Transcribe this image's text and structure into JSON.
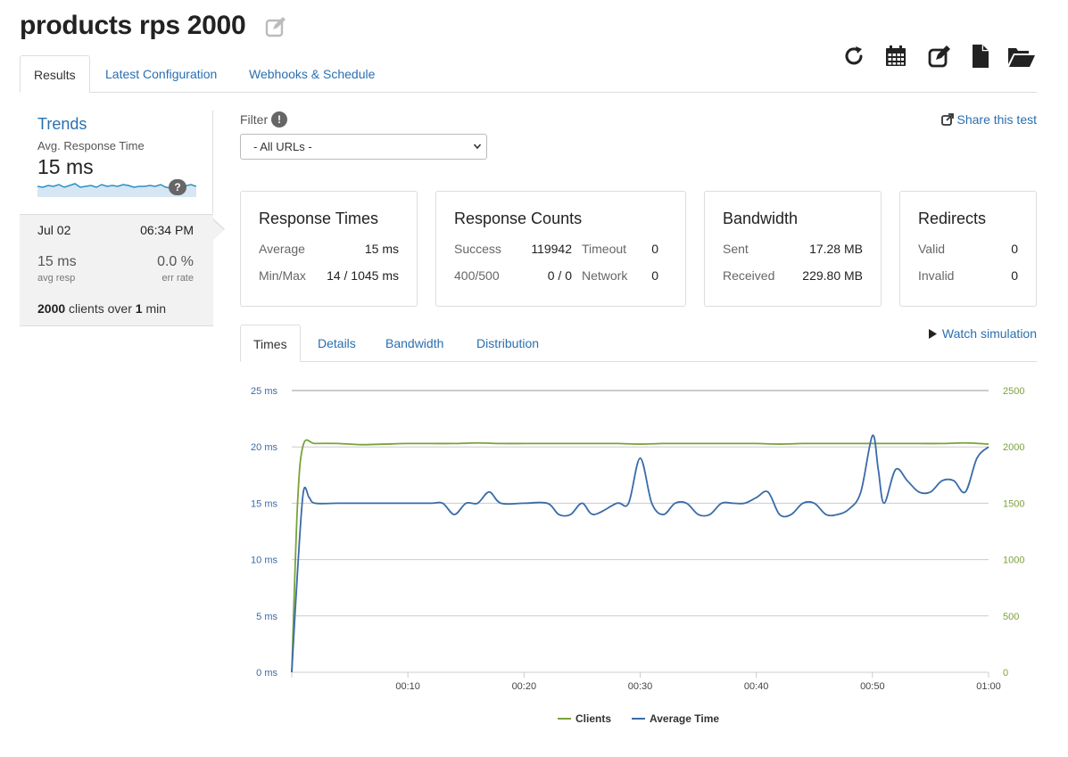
{
  "page": {
    "title": "products rps 2000"
  },
  "toolbar": {
    "icons": [
      "refresh-icon",
      "calendar-icon",
      "edit-icon",
      "document-icon",
      "folder-open-icon"
    ]
  },
  "tabs": [
    {
      "label": "Results",
      "active": true
    },
    {
      "label": "Latest Configuration",
      "active": false
    },
    {
      "label": "Webhooks & Schedule",
      "active": false
    }
  ],
  "trends": {
    "title": "Trends",
    "subtitle": "Avg. Response Time",
    "value": "15 ms",
    "help": "?"
  },
  "run": {
    "date": "Jul 02",
    "time": "06:34 PM",
    "avg_resp": "15 ms",
    "avg_resp_label": "avg resp",
    "err_rate": "0.0 %",
    "err_rate_label": "err rate",
    "clients_count": "2000",
    "clients_mid": "clients over",
    "duration": "1",
    "duration_unit": "min"
  },
  "filter": {
    "label": "Filter",
    "info": "!",
    "selected": "- All URLs -"
  },
  "share": {
    "label": "Share this test"
  },
  "response_times": {
    "title": "Response Times",
    "average_label": "Average",
    "average_value": "15 ms",
    "minmax_label": "Min/Max",
    "minmax_value": "14 / 1045 ms"
  },
  "response_counts": {
    "title": "Response Counts",
    "success_label": "Success",
    "success_value": "119942",
    "timeout_label": "Timeout",
    "timeout_value": "0",
    "err_label": "400/500",
    "err_value": "0 / 0",
    "network_label": "Network",
    "network_value": "0"
  },
  "bandwidth": {
    "title": "Bandwidth",
    "sent_label": "Sent",
    "sent_value": "17.28 MB",
    "received_label": "Received",
    "received_value": "229.80 MB"
  },
  "redirects": {
    "title": "Redirects",
    "valid_label": "Valid",
    "valid_value": "0",
    "invalid_label": "Invalid",
    "invalid_value": "0"
  },
  "chart_tabs": [
    {
      "label": "Times",
      "active": true
    },
    {
      "label": "Details",
      "active": false
    },
    {
      "label": "Bandwidth",
      "active": false
    },
    {
      "label": "Distribution",
      "active": false
    }
  ],
  "watch": {
    "label": "Watch simulation"
  },
  "colors": {
    "link": "#2a6fb0",
    "clients": "#7aa33a",
    "average_time": "#3a6ba8"
  },
  "chart_data": {
    "type": "line",
    "x_ticks": [
      "00:10",
      "00:20",
      "00:30",
      "00:40",
      "00:50",
      "01:00"
    ],
    "y_left_ticks": [
      "0 ms",
      "5 ms",
      "10 ms",
      "15 ms",
      "20 ms",
      "25 ms"
    ],
    "y_right_ticks": [
      "0",
      "500",
      "1000",
      "1500",
      "2000",
      "2500"
    ],
    "ylim_left": [
      0,
      25
    ],
    "ylim_right": [
      0,
      2500
    ],
    "xlim_seconds": [
      0,
      60
    ],
    "grid": true,
    "legend_position": "bottom-center",
    "series": [
      {
        "name": "Clients",
        "axis": "right",
        "color": "#7aa33a",
        "x": [
          0,
          0.5,
          1,
          2,
          4,
          6,
          8,
          10,
          12,
          14,
          16,
          18,
          20,
          22,
          24,
          26,
          28,
          30,
          32,
          34,
          36,
          38,
          40,
          42,
          44,
          46,
          48,
          50,
          52,
          54,
          56,
          58,
          60
        ],
        "values": [
          0,
          1500,
          2020,
          2030,
          2030,
          2020,
          2025,
          2030,
          2030,
          2030,
          2035,
          2030,
          2030,
          2030,
          2030,
          2030,
          2030,
          2025,
          2030,
          2030,
          2030,
          2030,
          2030,
          2025,
          2030,
          2030,
          2030,
          2030,
          2030,
          2030,
          2030,
          2035,
          2025
        ]
      },
      {
        "name": "Average Time",
        "axis": "left",
        "color": "#3a6ba8",
        "x": [
          0,
          0.5,
          1,
          1.5,
          2,
          4,
          6,
          8,
          10,
          12,
          13,
          14,
          15,
          16,
          17,
          18,
          20,
          22,
          23,
          24,
          25,
          26,
          28,
          29,
          30,
          31,
          32,
          33,
          34,
          35,
          36,
          37,
          38,
          39,
          40,
          41,
          42,
          43,
          44,
          45,
          46,
          47,
          48,
          49,
          50,
          50.5,
          51,
          52,
          53,
          54,
          55,
          56,
          57,
          58,
          59,
          60
        ],
        "values": [
          0,
          9,
          16,
          15.5,
          15,
          15,
          15,
          15,
          15,
          15,
          15,
          14,
          15,
          15,
          16,
          15,
          15,
          15,
          14,
          14,
          15,
          14,
          15,
          15,
          19,
          15,
          14,
          15,
          15,
          14,
          14,
          15,
          15,
          15,
          15.5,
          16,
          14,
          14,
          15,
          15,
          14,
          14,
          14.5,
          16,
          21,
          18,
          15,
          18,
          17,
          16,
          16,
          17,
          17,
          16,
          19,
          20
        ]
      }
    ]
  }
}
